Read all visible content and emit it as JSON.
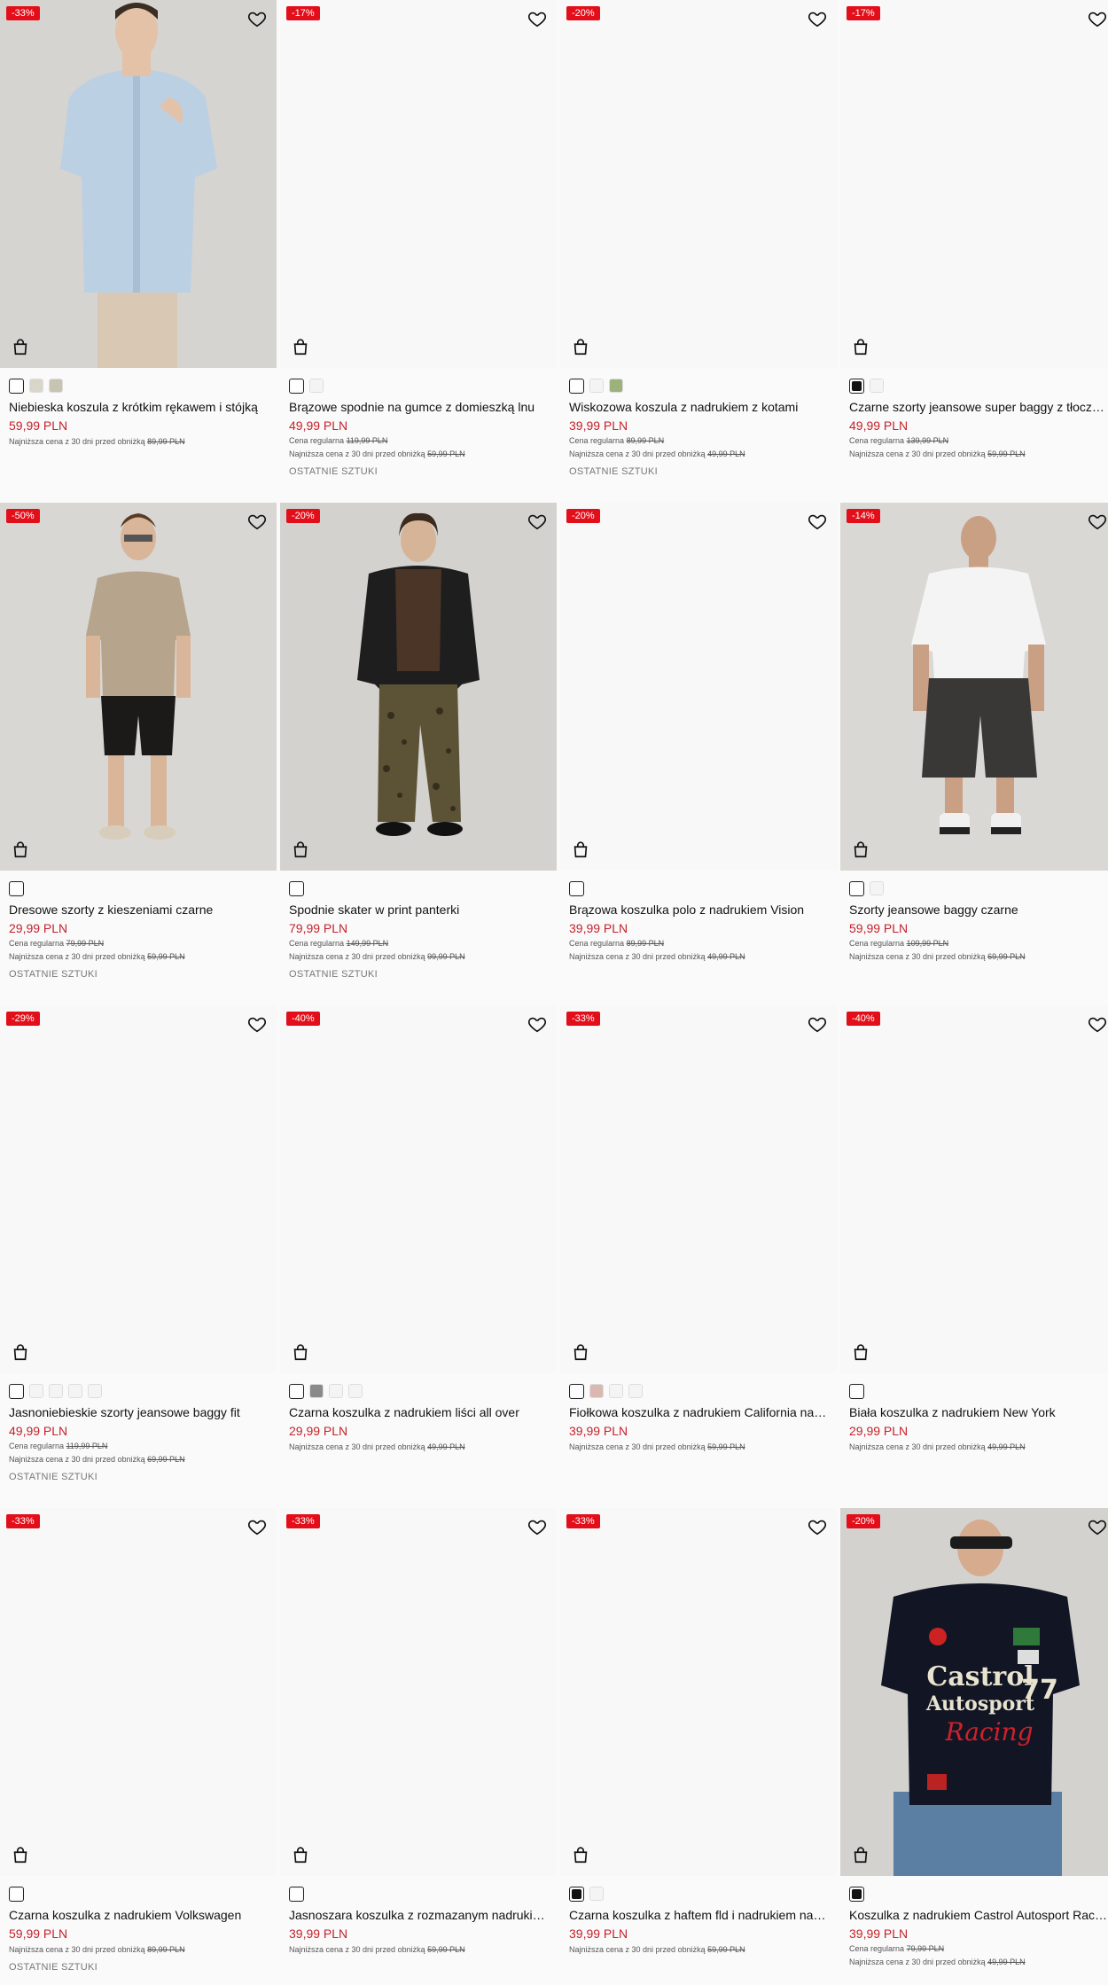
{
  "products": [
    {
      "badge": "-33%",
      "name": "Niebieska koszula z krótkim rękawem i stójką",
      "price": "59,99 PLN",
      "regular_label": "",
      "regular_price": "",
      "lowest_label": "Najniższa cena z 30 dni przed obniżką",
      "lowest_price": "89,99 PLN",
      "last_items": "",
      "swatches": [
        "#ffffff",
        "#d9d6c9",
        "#c8c4b2"
      ]
    },
    {
      "badge": "-17%",
      "name": "Brązowe spodnie na gumce z domieszką lnu",
      "price": "49,99 PLN",
      "regular_label": "Cena regularna",
      "regular_price": "119,99 PLN",
      "lowest_label": "Najniższa cena z 30 dni przed obniżką",
      "lowest_price": "59,99 PLN",
      "last_items": "OSTATNIE SZTUKI",
      "swatches": [
        "#ffffff",
        "#f4f4f4"
      ]
    },
    {
      "badge": "-20%",
      "name": "Wiskozowa koszula z nadrukiem z kotami",
      "price": "39,99 PLN",
      "regular_label": "Cena regularna",
      "regular_price": "89,99 PLN",
      "lowest_label": "Najniższa cena z 30 dni przed obniżką",
      "lowest_price": "49,99 PLN",
      "last_items": "OSTATNIE SZTUKI",
      "swatches": [
        "#ffffff",
        "#f4f4f4",
        "#9db27a"
      ]
    },
    {
      "badge": "-17%",
      "name": "Czarne szorty jeansowe super baggy z tłoczeniem",
      "price": "49,99 PLN",
      "regular_label": "Cena regularna",
      "regular_price": "139,99 PLN",
      "lowest_label": "Najniższa cena z 30 dni przed obniżką",
      "lowest_price": "59,99 PLN",
      "last_items": "",
      "swatches": [
        "#111111",
        "#f4f4f4"
      ]
    },
    {
      "badge": "-50%",
      "name": "Dresowe szorty z kieszeniami czarne",
      "price": "29,99 PLN",
      "regular_label": "Cena regularna",
      "regular_price": "79,99 PLN",
      "lowest_label": "Najniższa cena z 30 dni przed obniżką",
      "lowest_price": "59,99 PLN",
      "last_items": "OSTATNIE SZTUKI",
      "swatches": [
        "#ffffff"
      ]
    },
    {
      "badge": "-20%",
      "name": "Spodnie skater w print panterki",
      "price": "79,99 PLN",
      "regular_label": "Cena regularna",
      "regular_price": "149,99 PLN",
      "lowest_label": "Najniższa cena z 30 dni przed obniżką",
      "lowest_price": "99,99 PLN",
      "last_items": "OSTATNIE SZTUKI",
      "swatches": [
        "#ffffff"
      ]
    },
    {
      "badge": "-20%",
      "name": "Brązowa koszulka polo z nadrukiem Vision",
      "price": "39,99 PLN",
      "regular_label": "Cena regularna",
      "regular_price": "89,99 PLN",
      "lowest_label": "Najniższa cena z 30 dni przed obniżką",
      "lowest_price": "49,99 PLN",
      "last_items": "",
      "swatches": [
        "#ffffff"
      ]
    },
    {
      "badge": "-14%",
      "name": "Szorty jeansowe baggy czarne",
      "price": "59,99 PLN",
      "regular_label": "Cena regularna",
      "regular_price": "109,99 PLN",
      "lowest_label": "Najniższa cena z 30 dni przed obniżką",
      "lowest_price": "69,99 PLN",
      "last_items": "",
      "swatches": [
        "#ffffff",
        "#f4f4f4"
      ]
    },
    {
      "badge": "-29%",
      "name": "Jasnoniebieskie szorty jeansowe baggy fit",
      "price": "49,99 PLN",
      "regular_label": "Cena regularna",
      "regular_price": "119,99 PLN",
      "lowest_label": "Najniższa cena z 30 dni przed obniżką",
      "lowest_price": "69,99 PLN",
      "last_items": "OSTATNIE SZTUKI",
      "swatches": [
        "#ffffff",
        "#f4f4f4",
        "#f4f4f4",
        "#f4f4f4",
        "#f4f4f4"
      ]
    },
    {
      "badge": "-40%",
      "name": "Czarna koszulka z nadrukiem liści all over",
      "price": "29,99 PLN",
      "regular_label": "",
      "regular_price": "",
      "lowest_label": "Najniższa cena z 30 dni przed obniżką",
      "lowest_price": "49,99 PLN",
      "last_items": "",
      "swatches": [
        "#ffffff",
        "#8a8a8a",
        "#f4f4f4",
        "#f4f4f4"
      ]
    },
    {
      "badge": "-33%",
      "name": "Fiołkowa koszulka z nadrukiem California na plecach",
      "price": "39,99 PLN",
      "regular_label": "",
      "regular_price": "",
      "lowest_label": "Najniższa cena z 30 dni przed obniżką",
      "lowest_price": "59,99 PLN",
      "last_items": "",
      "swatches": [
        "#ffffff",
        "#d8b8b0",
        "#f4f4f4",
        "#f4f4f4"
      ]
    },
    {
      "badge": "-40%",
      "name": "Biała koszulka z nadrukiem New York",
      "price": "29,99 PLN",
      "regular_label": "",
      "regular_price": "",
      "lowest_label": "Najniższa cena z 30 dni przed obniżką",
      "lowest_price": "49,99 PLN",
      "last_items": "",
      "swatches": [
        "#ffffff"
      ]
    },
    {
      "badge": "-33%",
      "name": "Czarna koszulka z nadrukiem Volkswagen",
      "price": "59,99 PLN",
      "regular_label": "",
      "regular_price": "",
      "lowest_label": "Najniższa cena z 30 dni przed obniżką",
      "lowest_price": "89,99 PLN",
      "last_items": "OSTATNIE SZTUKI",
      "swatches": [
        "#ffffff"
      ]
    },
    {
      "badge": "-33%",
      "name": "Jasnoszara koszulka z rozmazanym nadrukiem all over",
      "price": "39,99 PLN",
      "regular_label": "",
      "regular_price": "",
      "lowest_label": "Najniższa cena z 30 dni przed obniżką",
      "lowest_price": "59,99 PLN",
      "last_items": "",
      "swatches": [
        "#ffffff"
      ]
    },
    {
      "badge": "-33%",
      "name": "Czarna koszulka z haftem fld i nadrukiem na plecach",
      "price": "39,99 PLN",
      "regular_label": "",
      "regular_price": "",
      "lowest_label": "Najniższa cena z 30 dni przed obniżką",
      "lowest_price": "59,99 PLN",
      "last_items": "",
      "swatches": [
        "#111111",
        "#f4f4f4"
      ]
    },
    {
      "badge": "-20%",
      "name": "Koszulka z nadrukiem Castrol Autosport Racing",
      "price": "39,99 PLN",
      "regular_label": "Cena regularna",
      "regular_price": "79,99 PLN",
      "lowest_label": "Najniższa cena z 30 dni przed obniżką",
      "lowest_price": "49,99 PLN",
      "last_items": "",
      "swatches": [
        "#111111"
      ]
    }
  ],
  "images": [
    "shirt-blue",
    "blank",
    "blank",
    "blank",
    "tee-shorts",
    "jacket-pants",
    "blank",
    "tee-white-shorts",
    "blank",
    "blank",
    "blank",
    "blank",
    "blank",
    "blank",
    "blank",
    "tee-castrol"
  ],
  "print_text": {
    "line1": "Castrol",
    "line2": "Autosport",
    "line3": "Racing",
    "number": "77"
  },
  "colors": {
    "badge": "#e20f1a",
    "price": "#c4222b"
  }
}
